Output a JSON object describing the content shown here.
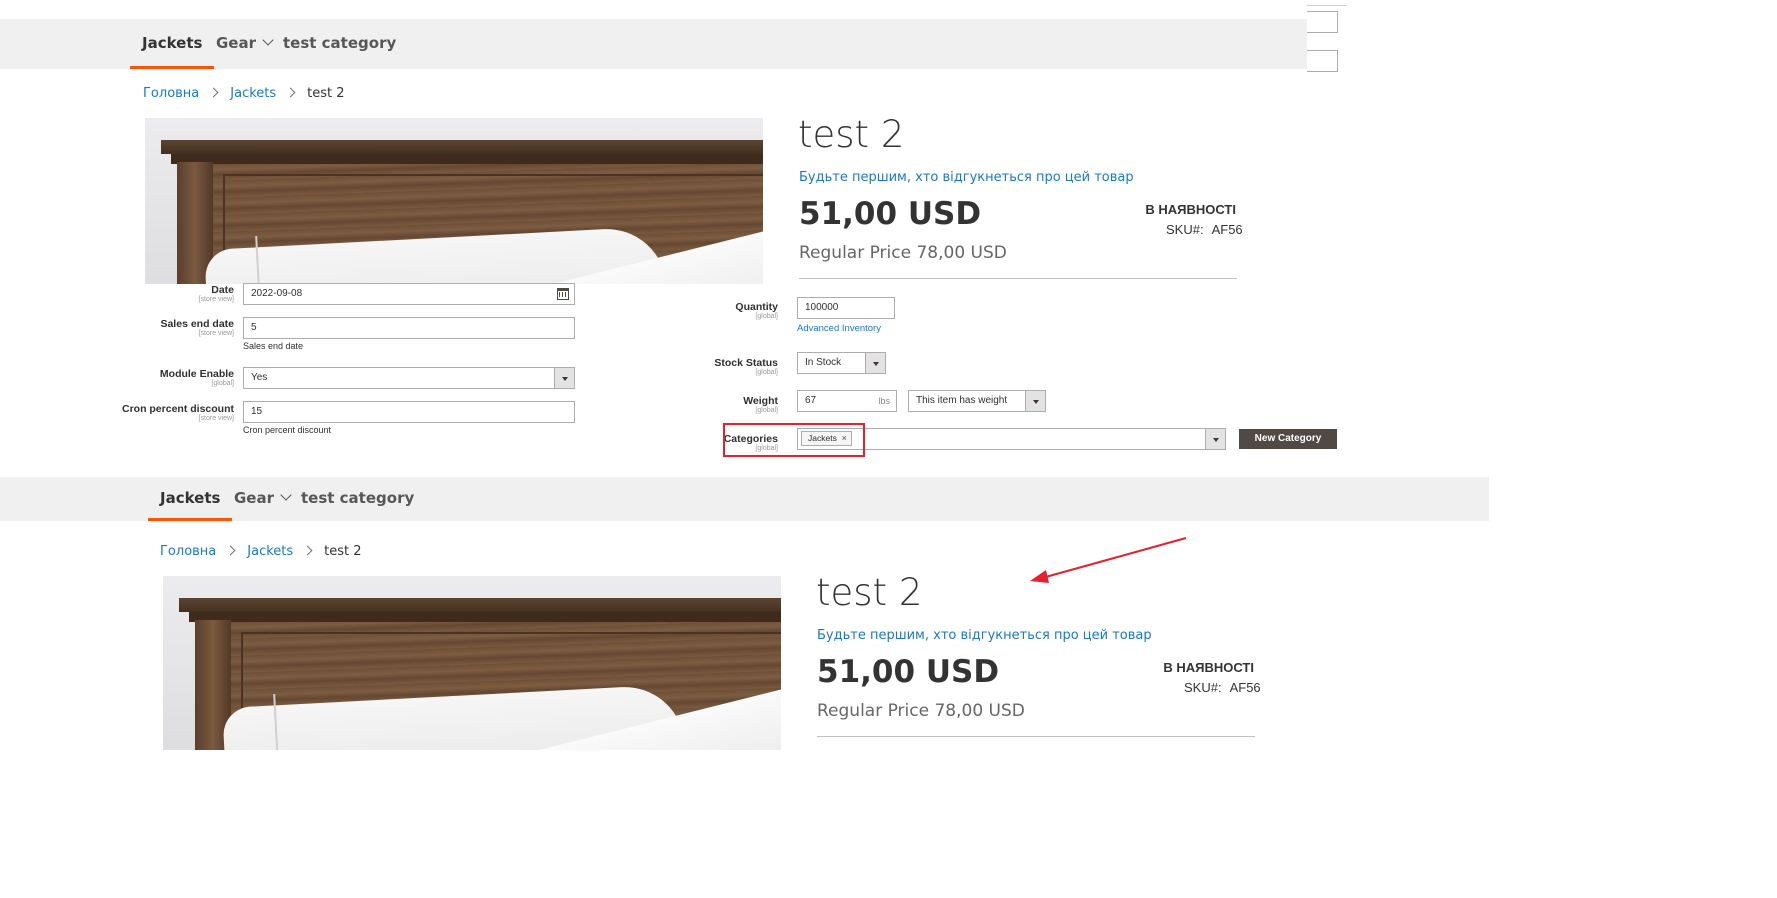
{
  "top_shot": {
    "nav": {
      "items": [
        {
          "label": "Jackets"
        },
        {
          "label": "Gear"
        },
        {
          "label": "test category"
        }
      ]
    },
    "breadcrumbs": [
      {
        "label": "Головна"
      },
      {
        "label": "Jackets"
      },
      {
        "label": "test 2"
      }
    ],
    "product": {
      "title": "test 2",
      "review_link": "Будьте першим, хто відгукнеться про цей товар",
      "price": "51,00 USD",
      "regular_price": "Regular Price 78,00 USD",
      "stock": "В НАЯВНОСТІ",
      "sku_label": "SKU#:",
      "sku_value": "AF56"
    }
  },
  "admin_form": {
    "left": {
      "date": {
        "label": "Date",
        "scope": "[store view]",
        "value": "2022-09-08"
      },
      "sales_end_date": {
        "label": "Sales end date",
        "scope": "[store view]",
        "value": "5",
        "note": "Sales end date"
      },
      "module_enable": {
        "label": "Module Enable",
        "scope": "[global]",
        "value": "Yes"
      },
      "cron_percent_discount": {
        "label": "Cron percent discount",
        "scope": "[store view]",
        "value": "15",
        "note": "Cron percent discount"
      }
    },
    "right": {
      "quantity": {
        "label": "Quantity",
        "scope": "[global]",
        "value": "100000",
        "link": "Advanced Inventory"
      },
      "stock_status": {
        "label": "Stock Status",
        "scope": "[global]",
        "value": "In Stock"
      },
      "weight": {
        "label": "Weight",
        "scope": "[global]",
        "value": "67",
        "unit": "lbs",
        "has_weight": "This item has weight"
      },
      "categories": {
        "label": "Categories",
        "scope": "[global]",
        "tags": [
          "Jackets"
        ],
        "new_button": "New Category"
      }
    }
  },
  "bottom_shot": {
    "nav": {
      "items": [
        {
          "label": "Jackets"
        },
        {
          "label": "Gear"
        },
        {
          "label": "test category"
        }
      ]
    },
    "breadcrumbs": [
      {
        "label": "Головна"
      },
      {
        "label": "Jackets"
      },
      {
        "label": "test 2"
      }
    ],
    "product": {
      "title": "test 2",
      "review_link": "Будьте першим, хто відгукнеться про цей товар",
      "price": "51,00 USD",
      "regular_price": "Regular Price 78,00 USD",
      "stock": "В НАЯВНОСТІ",
      "sku_label": "SKU#:",
      "sku_value": "AF56"
    }
  },
  "colors": {
    "accent": "#ff5501",
    "link": "#1979c3",
    "highlight": "#e4222d",
    "button": "#514943"
  }
}
